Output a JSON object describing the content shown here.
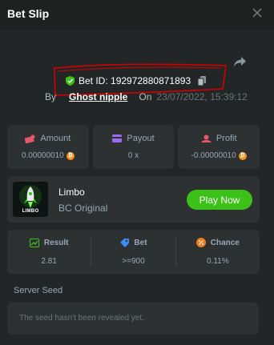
{
  "header": {
    "title": "Bet Slip"
  },
  "bet": {
    "id_text": "Bet ID: 192972880871893",
    "by_label": "By",
    "username": "Ghost nipple",
    "on_label": "On",
    "datetime": "23/07/2022, 15:39:12"
  },
  "stats": [
    {
      "label": "Amount",
      "value": "0.00000010",
      "icon": "money-icon",
      "has_coin": true
    },
    {
      "label": "Payout",
      "value": "0 x",
      "icon": "payout-card-icon",
      "has_coin": false
    },
    {
      "label": "Profit",
      "value": "-0.00000010",
      "icon": "profit-icon",
      "has_coin": true
    }
  ],
  "game": {
    "name": "Limbo",
    "provider": "BC Original",
    "thumb_label": "LIMBO",
    "play_label": "Play Now"
  },
  "details": [
    {
      "label": "Result",
      "value": "2.81",
      "icon": "result-chart-icon"
    },
    {
      "label": "Bet",
      "value": ">=900",
      "icon": "bet-tag-icon"
    },
    {
      "label": "Chance",
      "value": "0.11%",
      "icon": "percent-icon"
    }
  ],
  "seed": {
    "label": "Server Seed",
    "message": "The seed hasn't been revealed yet."
  },
  "colors": {
    "background": "#232626",
    "card": "#2d3131",
    "accent_green": "#3bc117",
    "coin_orange": "#f7931a",
    "annotation_red": "#d40000"
  }
}
